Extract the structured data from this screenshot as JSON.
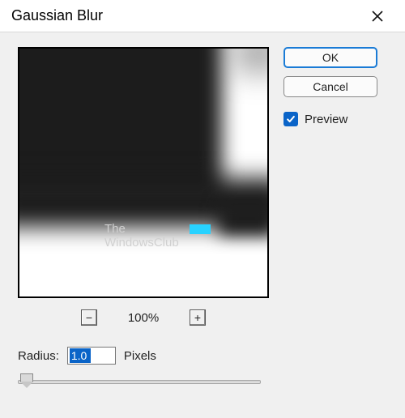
{
  "dialog": {
    "title": "Gaussian Blur"
  },
  "buttons": {
    "ok": "OK",
    "cancel": "Cancel"
  },
  "preview_checkbox": {
    "label": "Preview",
    "checked": true
  },
  "zoom": {
    "level": "100%"
  },
  "radius": {
    "label": "Radius:",
    "value": "1.0",
    "unit": "Pixels"
  },
  "watermark": {
    "line1": "The",
    "line2": "WindowsClub"
  }
}
